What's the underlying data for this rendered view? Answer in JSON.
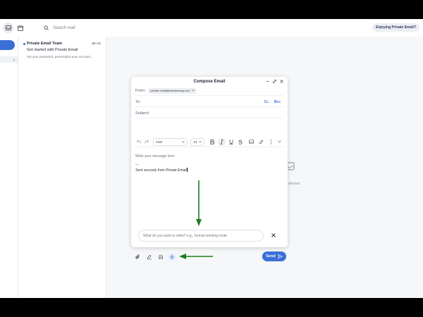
{
  "topbar": {
    "search_placeholder": "Search mail",
    "promo_label": "Enjoying Private Email?"
  },
  "sidebar": {
    "inbox_count": "1"
  },
  "mail_list": {
    "items": [
      {
        "sender": "Private Email Team",
        "date": "Jan 02",
        "subject": "Get started with Private Email",
        "snippet": "Set your password, personalize your account..."
      }
    ]
  },
  "reader": {
    "empty_text": "elected"
  },
  "compose": {
    "title": "Compose Email",
    "from_label": "From:",
    "from_value": "private.email@namecheap.com",
    "to_label": "To:",
    "cc_label": "Cc",
    "bcc_label": "Bcc",
    "subject_label": "Subject:",
    "font_family": "Arial",
    "font_size": "14",
    "body_placeholder": "Write your message here",
    "signature_dash": "---",
    "signature_text": "Sent securely from Private Email",
    "ai_placeholder": "What do you want to write? e.g., formal meeting invite",
    "send_label": "Send"
  },
  "colors": {
    "accent": "#3b6fd8",
    "annotation_arrow": "#1e7d1e"
  }
}
